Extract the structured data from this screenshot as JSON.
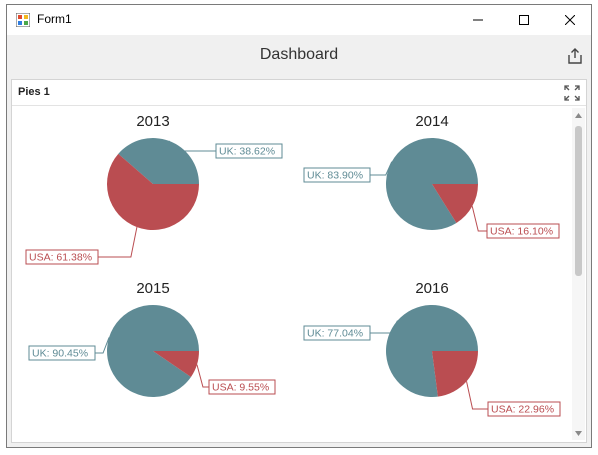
{
  "window": {
    "title": "Form1",
    "icon": "winforms-app-icon",
    "controls": [
      "minimize-icon",
      "maximize-icon",
      "close-icon"
    ]
  },
  "dashboard": {
    "title": "Dashboard",
    "export_icon": "export-icon"
  },
  "panel": {
    "title": "Pies 1",
    "maximize_icon": "fullscreen-icon"
  },
  "colors": {
    "uk": "#5f8b95",
    "usa": "#ba4d51"
  },
  "chart_data": [
    {
      "type": "pie",
      "title": "2013",
      "slices": [
        {
          "label": "UK",
          "text": "UK: 38.62%",
          "value": 38.62
        },
        {
          "label": "USA",
          "text": "USA: 61.38%",
          "value": 61.38
        }
      ]
    },
    {
      "type": "pie",
      "title": "2014",
      "slices": [
        {
          "label": "UK",
          "text": "UK: 83.90%",
          "value": 83.9
        },
        {
          "label": "USA",
          "text": "USA: 16.10%",
          "value": 16.1
        }
      ]
    },
    {
      "type": "pie",
      "title": "2015",
      "slices": [
        {
          "label": "UK",
          "text": "UK: 90.45%",
          "value": 90.45
        },
        {
          "label": "USA",
          "text": "USA: 9.55%",
          "value": 9.55
        }
      ]
    },
    {
      "type": "pie",
      "title": "2016",
      "slices": [
        {
          "label": "UK",
          "text": "UK: 77.04%",
          "value": 77.04
        },
        {
          "label": "USA",
          "text": "USA: 22.96%",
          "value": 22.96
        }
      ]
    }
  ]
}
